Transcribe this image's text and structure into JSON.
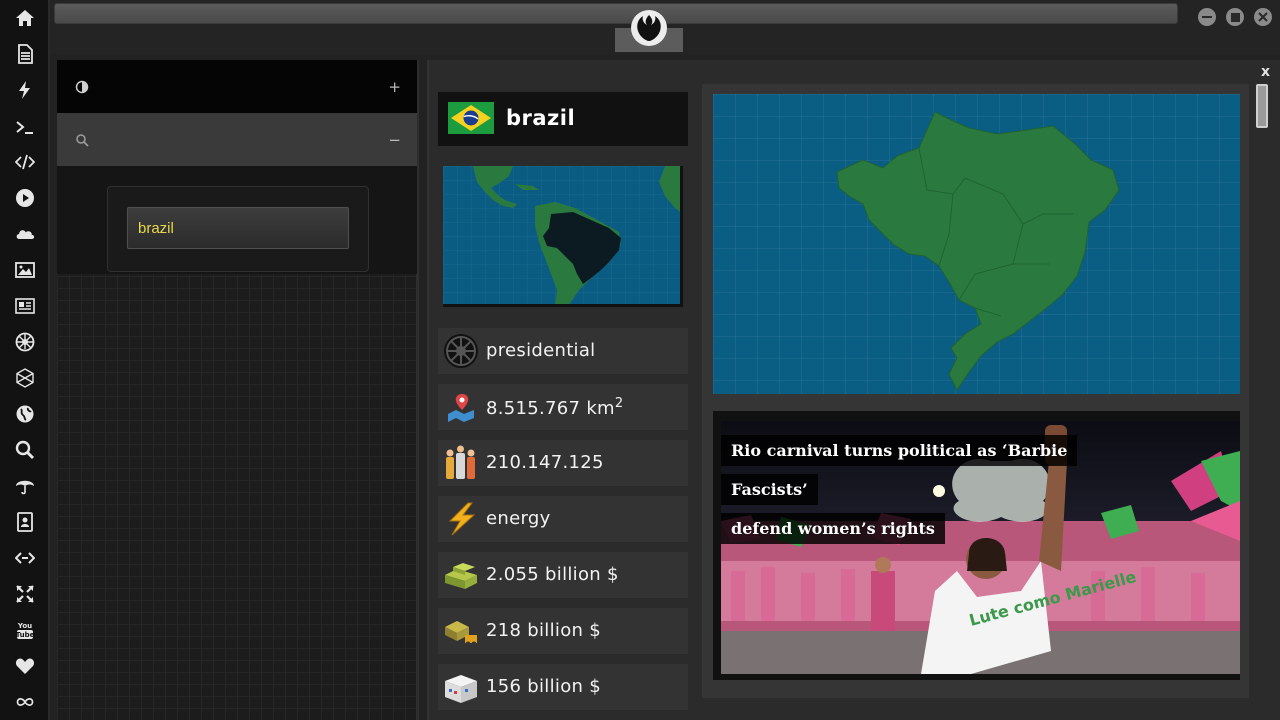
{
  "rail": {
    "icons": [
      "home-icon",
      "document-icon",
      "lightning-icon",
      "terminal-icon",
      "code-icon",
      "play-icon",
      "cloud-icon",
      "image-icon",
      "newspaper-icon",
      "empire-icon",
      "hexagon-icon",
      "globe-icon",
      "search-icon",
      "umbrella-icon",
      "contacts-icon",
      "link-icon",
      "expand-icon",
      "youtube-icon",
      "heart-icon",
      "infinity-icon"
    ],
    "youtube_label": "You Tube"
  },
  "left": {
    "panel1_toggle": "+",
    "panel2_toggle": "−",
    "search_value": "brazil"
  },
  "country": {
    "name": "brazil",
    "government": "presidential",
    "area": "8.515.767 km",
    "area_unit_power": "2",
    "population": "210.147.125",
    "category": "energy",
    "value1": "2.055 billion $",
    "value2": "218 billion $",
    "value3": "156 billion $"
  },
  "news": {
    "title": "Rio carnival turns political as ‘Barbie Fascists’ defend women’s rights",
    "title_line1": "Rio carnival turns political as ‘Barbie Fascists’",
    "title_line2": "defend women’s rights",
    "shirt_text": "Lute como Marielle"
  },
  "main": {
    "close_label": "x"
  },
  "colors": {
    "rail_bg": "#121212",
    "map_ocean": "#0a5d83",
    "map_land": "#2a7a3f",
    "accent_yellow": "#e8d94a"
  }
}
